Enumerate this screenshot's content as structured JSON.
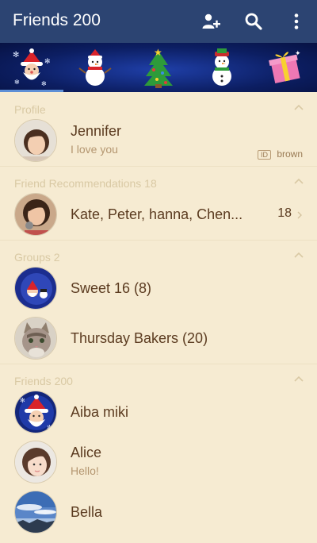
{
  "topbar": {
    "title": "Friends 200",
    "icons": [
      "add-friend-icon",
      "search-icon",
      "more-vertical-icon"
    ]
  },
  "tabs": [
    {
      "icon": "santa-sticker-icon",
      "selected": true
    },
    {
      "icon": "snowman-sticker-icon",
      "selected": false
    },
    {
      "icon": "christmas-tree-sticker-icon",
      "selected": false
    },
    {
      "icon": "snowman-hat-sticker-icon",
      "selected": false
    },
    {
      "icon": "gift-box-sticker-icon",
      "selected": false
    }
  ],
  "sections": {
    "profile": {
      "label": "Profile"
    },
    "recommendations": {
      "label": "Friend Recommendations 18"
    },
    "groups": {
      "label": "Groups 2"
    },
    "friends": {
      "label": "Friends 200"
    }
  },
  "profile": {
    "name": "Jennifer",
    "status": "I love you",
    "id_badge": "ID",
    "id_value": "brown"
  },
  "recommendations": {
    "names": "Kate, Peter, hanna, Chen...",
    "count": "18"
  },
  "groups": [
    {
      "name": "Sweet 16 (8)"
    },
    {
      "name": "Thursday Bakers (20)"
    }
  ],
  "friends": [
    {
      "name": "Aiba miki",
      "status": ""
    },
    {
      "name": "Alice",
      "status": "Hello!"
    },
    {
      "name": "Bella",
      "status": ""
    }
  ],
  "colors": {
    "topbar": "#2c4472",
    "background": "#f6ebd2",
    "name_text": "#5b3b20",
    "header_text": "#d9c9a4"
  }
}
